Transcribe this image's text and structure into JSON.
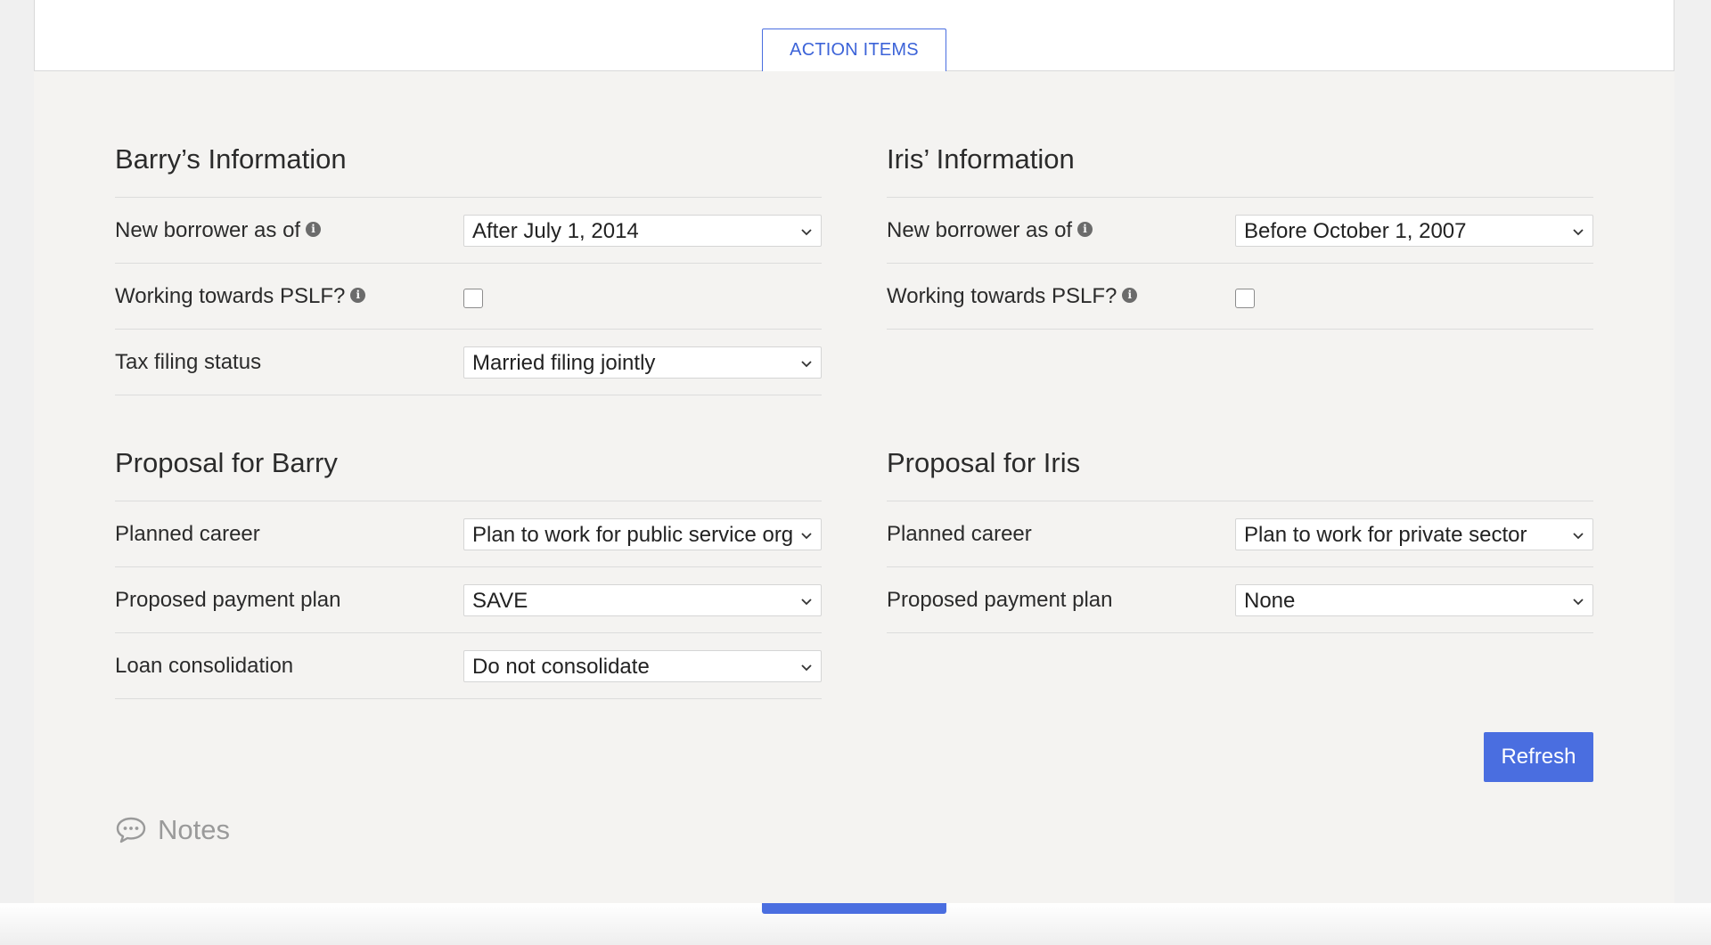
{
  "tabs": {
    "action_items": "ACTION ITEMS"
  },
  "barry_info": {
    "title": "Barry’s Information",
    "rows": [
      {
        "label": "New borrower as of",
        "value": "After July 1, 2014"
      },
      {
        "label": "Working towards PSLF?",
        "checked": false
      },
      {
        "label": "Tax filing status",
        "value": "Married filing jointly"
      }
    ]
  },
  "iris_info": {
    "title": "Iris’ Information",
    "rows": [
      {
        "label": "New borrower as of",
        "value": "Before October 1, 2007"
      },
      {
        "label": "Working towards PSLF?",
        "checked": false
      }
    ]
  },
  "barry_proposal": {
    "title": "Proposal for Barry",
    "rows": [
      {
        "label": "Planned career",
        "value": "Plan to work for public service organization"
      },
      {
        "label": "Proposed payment plan",
        "value": "SAVE"
      },
      {
        "label": "Loan consolidation",
        "value": "Do not consolidate"
      }
    ]
  },
  "iris_proposal": {
    "title": "Proposal for Iris",
    "rows": [
      {
        "label": "Planned career",
        "value": "Plan to work for private sector"
      },
      {
        "label": "Proposed payment plan",
        "value": "None"
      }
    ]
  },
  "info_icon_glyph": "i",
  "refresh_label": "Refresh",
  "notes_label": "Notes",
  "colors": {
    "accent": "#4a6ee0",
    "panel_bg": "#f4f3f1"
  }
}
